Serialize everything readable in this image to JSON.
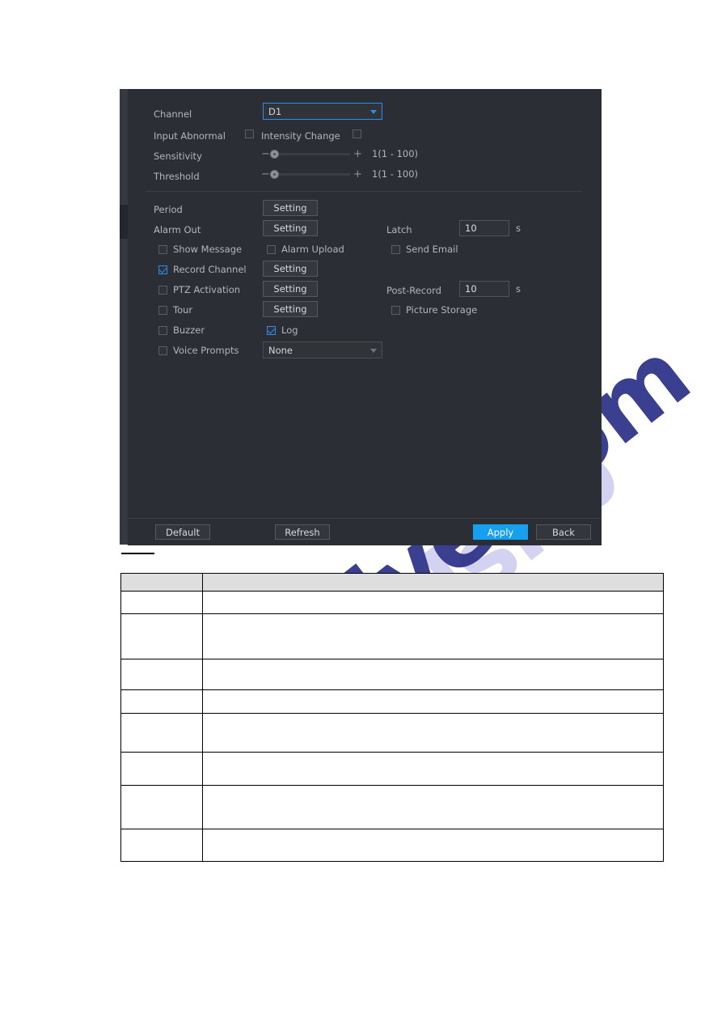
{
  "dialog": {
    "fields": {
      "channel_label": "Channel",
      "channel_value": "D1",
      "input_abnormal_label": "Input Abnormal",
      "intensity_change_label": "Intensity Change",
      "sensitivity_label": "Sensitivity",
      "sensitivity_value": "1(1 - 100)",
      "threshold_label": "Threshold",
      "threshold_value": "1(1 - 100)",
      "period_label": "Period",
      "alarm_out_label": "Alarm Out",
      "latch_label": "Latch",
      "latch_value": "10",
      "latch_unit": "s",
      "show_message_label": "Show Message",
      "alarm_upload_label": "Alarm Upload",
      "send_email_label": "Send Email",
      "record_channel_label": "Record Channel",
      "ptz_activation_label": "PTZ Activation",
      "post_record_label": "Post-Record",
      "post_record_value": "10",
      "post_record_unit": "s",
      "tour_label": "Tour",
      "picture_storage_label": "Picture Storage",
      "buzzer_label": "Buzzer",
      "log_label": "Log",
      "voice_prompts_label": "Voice Prompts",
      "voice_prompts_value": "None",
      "setting_button_label": "Setting"
    },
    "footer": {
      "default_label": "Default",
      "refresh_label": "Refresh",
      "apply_label": "Apply",
      "back_label": "Back"
    },
    "colors": {
      "accent": "#18a0f0",
      "focus_border": "#2d8cf0",
      "panel_bg": "#2b2e35"
    }
  },
  "spec_table": {
    "headers": [
      "",
      ""
    ],
    "rows": [
      [
        "",
        ""
      ],
      [
        "",
        ""
      ],
      [
        "",
        ""
      ],
      [
        "",
        ""
      ],
      [
        "",
        ""
      ],
      [
        "",
        ""
      ],
      [
        "",
        ""
      ]
    ]
  },
  "watermark": {
    "text_a": "manualslib",
    "text_b": "ive.com"
  }
}
